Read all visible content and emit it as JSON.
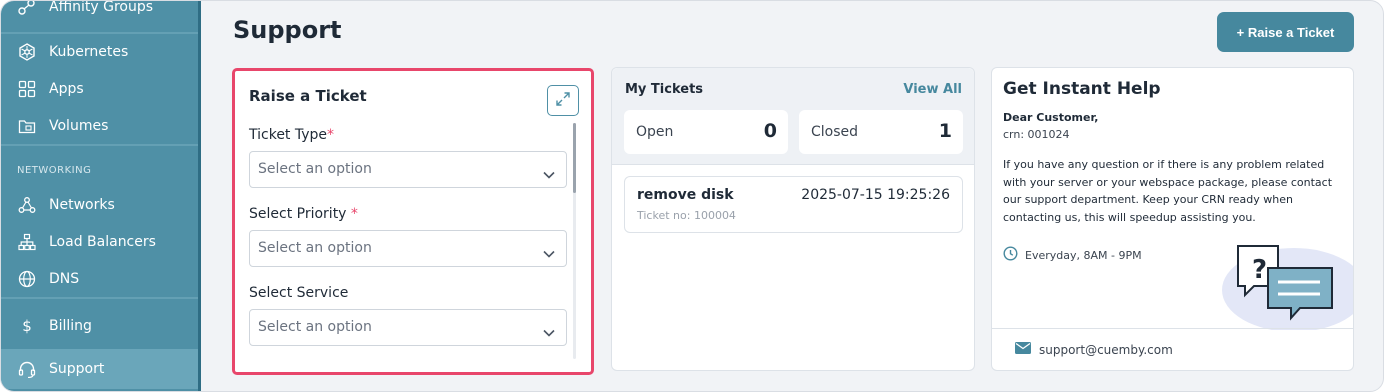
{
  "sidebar": {
    "items_top": [
      {
        "label": "Affinity Groups",
        "icon": "affinity-groups-icon"
      },
      {
        "label": "Kubernetes",
        "icon": "kubernetes-icon"
      },
      {
        "label": "Apps",
        "icon": "apps-grid-icon"
      },
      {
        "label": "Volumes",
        "icon": "volumes-folder-icon"
      }
    ],
    "section_networking": "NETWORKING",
    "items_networking": [
      {
        "label": "Networks",
        "icon": "networks-icon"
      },
      {
        "label": "Load Balancers",
        "icon": "load-balancers-icon"
      },
      {
        "label": "DNS",
        "icon": "globe-icon"
      }
    ],
    "billing": {
      "label": "Billing",
      "icon": "dollar-icon"
    },
    "support": {
      "label": "Support",
      "icon": "headset-icon"
    }
  },
  "header": {
    "title": "Support",
    "raise_button": "+ Raise a Ticket"
  },
  "raise_ticket": {
    "title": "Raise a Ticket",
    "fields": [
      {
        "label": "Ticket Type",
        "required_mark": "*",
        "placeholder": "Select an option"
      },
      {
        "label": "Select Priority ",
        "required_mark": "*",
        "placeholder": "Select an option"
      },
      {
        "label": "Select Service",
        "required_mark": "",
        "placeholder": "Select an option"
      }
    ]
  },
  "my_tickets": {
    "title": "My Tickets",
    "view_all": "View All",
    "open_label": "Open",
    "open_count": "0",
    "closed_label": "Closed",
    "closed_count": "1",
    "tickets": [
      {
        "name": "remove disk",
        "date": "2025-07-15 19:25:26",
        "ticket_no": "Ticket no: 100004"
      }
    ]
  },
  "help": {
    "title": "Get Instant Help",
    "greeting": "Dear Customer,",
    "crn": "crn: 001024",
    "message": "If you have any question or if there is any problem related with your server or your webspace package, please contact our support department. Keep your CRN ready when contacting us, this will speedup assisting you.",
    "hours": "Everyday, 8AM - 9PM",
    "email": "support@cuemby.com"
  },
  "colors": {
    "sidebar": "#4f90a6",
    "accent": "#46889e",
    "highlight_border": "#e8466b",
    "required": "#e8466b"
  }
}
